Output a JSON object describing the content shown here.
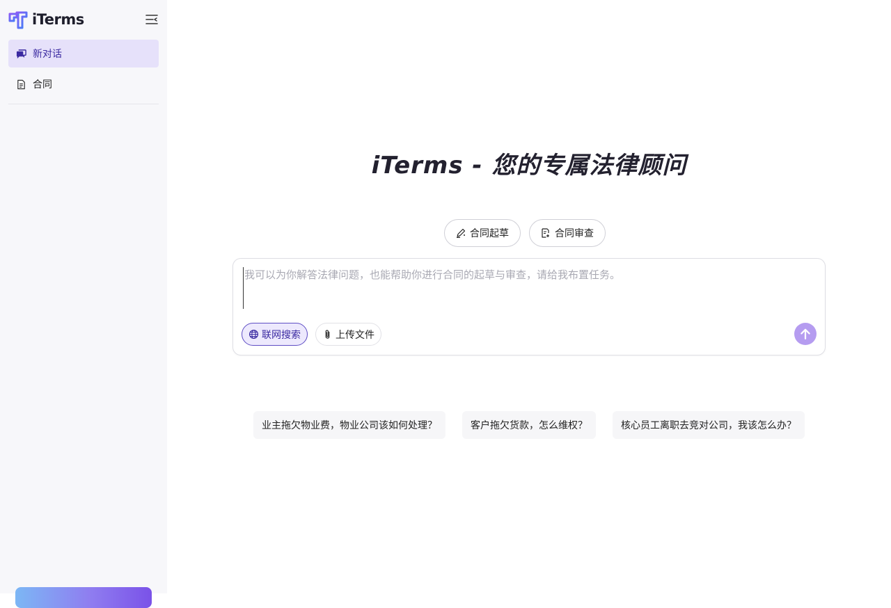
{
  "sidebar": {
    "logo_text": "iTerms",
    "items": [
      {
        "label": "新对话",
        "icon": "chat-bubbles-icon",
        "active": true
      },
      {
        "label": "合同",
        "icon": "document-icon",
        "active": false
      }
    ]
  },
  "main": {
    "title": "iTerms - 您的专属法律顾问",
    "modes": [
      {
        "label": "合同起草",
        "icon": "pen-draft-icon"
      },
      {
        "label": "合同审查",
        "icon": "document-review-icon"
      }
    ],
    "composer": {
      "placeholder": "我可以为你解答法律问题，也能帮助你进行合同的起草与审查，请给我布置任务。",
      "tools": [
        {
          "label": "联网搜索",
          "icon": "globe-icon",
          "active": true
        },
        {
          "label": "上传文件",
          "icon": "paperclip-icon",
          "active": false
        }
      ],
      "send_icon": "arrow-up-icon"
    },
    "suggestions": [
      "业主拖欠物业费，物业公司该如何处理？",
      "客户拖欠货款，怎么维权？",
      "核心员工离职去竞对公司，我该怎么办？"
    ]
  },
  "colors": {
    "accent": "#5d4cc4",
    "active_bg": "#e6e1fa",
    "send_button": "#b59cf0",
    "sidebar_bg": "#f7f7fa"
  }
}
